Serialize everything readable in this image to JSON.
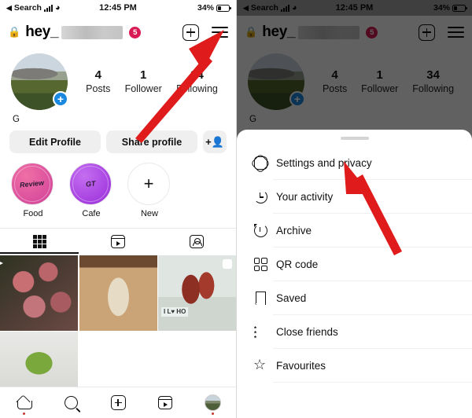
{
  "status_bar": {
    "carrier_back": "Search",
    "back_caret": "◀",
    "time": "12:45 PM",
    "battery_pct": "34%",
    "wifi_icon": "wifi-icon",
    "signal_icon": "signal-bars-icon"
  },
  "profile_header": {
    "lock_icon": "lock-icon",
    "username": "hey_",
    "username_blurred": true,
    "notification_badge": "5",
    "add_icon_name": "plus-square-icon",
    "menu_icon_name": "hamburger-menu-icon"
  },
  "profile": {
    "avatar_name": "profile-avatar",
    "add_story_label": "+",
    "display_name": "G",
    "stats": [
      {
        "value": "4",
        "label": "Posts"
      },
      {
        "value": "1",
        "label": "Follower"
      },
      {
        "value": "34",
        "label": "Following"
      }
    ]
  },
  "actions": {
    "edit_profile": "Edit Profile",
    "share_profile": "Share profile",
    "add_person_icon": "add-person-icon"
  },
  "highlights": [
    {
      "label": "Food",
      "cover_text": "Review",
      "style": "food"
    },
    {
      "label": "Cafe",
      "cover_text": "GT",
      "style": "cafe"
    },
    {
      "label": "New",
      "cover_text": "+",
      "style": "new"
    }
  ],
  "tabs": [
    {
      "name": "grid",
      "icon": "grid-icon",
      "active": true
    },
    {
      "name": "reels",
      "icon": "reels-icon",
      "active": false
    },
    {
      "name": "tagged",
      "icon": "tagged-icon",
      "active": false
    }
  ],
  "posts": [
    {
      "id": "post-1",
      "kind": "reel",
      "badge_icon": "reel-icon",
      "alt": "crochet flowers"
    },
    {
      "id": "post-2",
      "kind": "photo",
      "badge_icon": "",
      "alt": "woven basket"
    },
    {
      "id": "post-3",
      "kind": "carousel",
      "badge_icon": "carousel-icon",
      "alt": "hand holding red craft",
      "overlay_text": "I L♥\nHO"
    },
    {
      "id": "post-4",
      "kind": "photo",
      "badge_icon": "",
      "alt": "android mascot figurine"
    }
  ],
  "bottom_nav": [
    {
      "name": "home",
      "icon": "home-icon",
      "dot": true
    },
    {
      "name": "search",
      "icon": "search-icon",
      "dot": false
    },
    {
      "name": "create",
      "icon": "add-square-icon",
      "dot": false
    },
    {
      "name": "reels",
      "icon": "reels-icon",
      "dot": false
    },
    {
      "name": "profile",
      "icon": "profile-avatar-icon",
      "dot": true
    }
  ],
  "menu_sheet": {
    "handle_name": "sheet-drag-handle",
    "items": [
      {
        "label": "Settings and privacy",
        "icon": "gear-icon"
      },
      {
        "label": "Your activity",
        "icon": "activity-clock-icon"
      },
      {
        "label": "Archive",
        "icon": "archive-clock-icon"
      },
      {
        "label": "QR code",
        "icon": "qr-code-icon"
      },
      {
        "label": "Saved",
        "icon": "bookmark-icon"
      },
      {
        "label": "Close friends",
        "icon": "close-friends-list-icon"
      },
      {
        "label": "Favourites",
        "icon": "star-icon"
      }
    ]
  },
  "annotations": {
    "arrow_color": "#e01b1b",
    "arrow_left_target": "hamburger-menu-icon",
    "arrow_right_target": "Settings and privacy"
  }
}
